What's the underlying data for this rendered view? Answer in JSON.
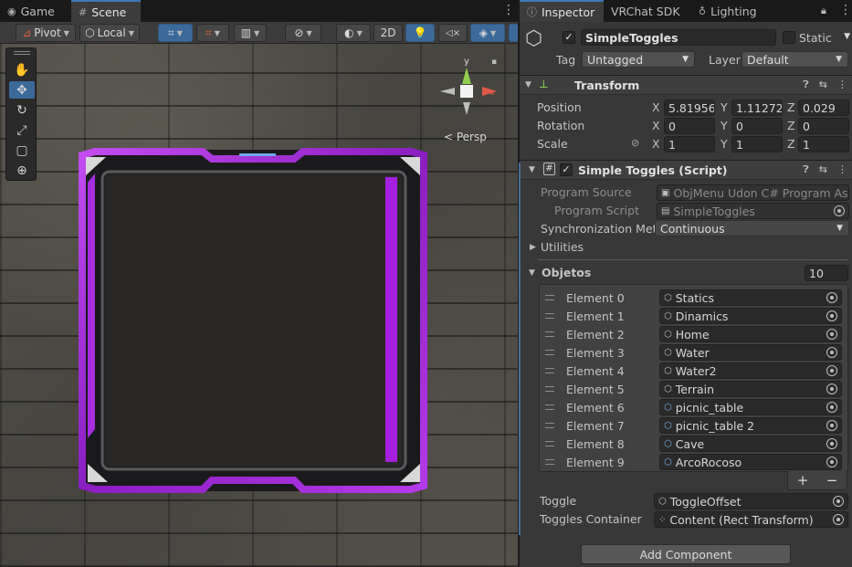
{
  "scene_tabs": [
    {
      "label": "Game",
      "icon": "gamepad-icon"
    },
    {
      "label": "Scene",
      "icon": "grid-icon"
    }
  ],
  "scene_toolbar": {
    "pivot_label": "Pivot",
    "local_label": "Local",
    "mode_2d_label": "2D"
  },
  "scene": {
    "projection_label": "< Persp",
    "gizmo_y": "y",
    "gizmo_x": "x",
    "frame_accent": "#a61fe0"
  },
  "inspector_tabs": [
    {
      "label": "Inspector",
      "icon": "info-icon"
    },
    {
      "label": "VRChat SDK",
      "icon": ""
    },
    {
      "label": "Lighting",
      "icon": "bulb-icon"
    }
  ],
  "gameobject": {
    "name": "SimpleToggles",
    "static_label": "Static",
    "tag_label": "Tag",
    "tag_value": "Untagged",
    "layer_label": "Layer",
    "layer_value": "Default"
  },
  "transform": {
    "title": "Transform",
    "position_label": "Position",
    "rotation_label": "Rotation",
    "scale_label": "Scale",
    "position": {
      "x": "5.819569",
      "y": "1.112724",
      "z": "0.029"
    },
    "rotation": {
      "x": "0",
      "y": "0",
      "z": "0"
    },
    "scale": {
      "x": "1",
      "y": "1",
      "z": "1"
    },
    "axis_x": "X",
    "axis_y": "Y",
    "axis_z": "Z"
  },
  "script": {
    "title": "Simple Toggles (Script)",
    "program_source_label": "Program Source",
    "program_source_value": "ObjMenu Udon C# Program Ass",
    "program_script_label": "Program Script",
    "program_script_value": "SimpleToggles",
    "sync_label": "Synchronization Meth",
    "sync_value": "Continuous",
    "utilities_label": "Utilities",
    "objetos_label": "Objetos",
    "objetos_count": "10",
    "elements": [
      {
        "label": "Element 0",
        "value": "Statics",
        "prefab": false
      },
      {
        "label": "Element 1",
        "value": "Dinamics",
        "prefab": false
      },
      {
        "label": "Element 2",
        "value": "Home",
        "prefab": false
      },
      {
        "label": "Element 3",
        "value": "Water",
        "prefab": false
      },
      {
        "label": "Element 4",
        "value": "Water2",
        "prefab": false
      },
      {
        "label": "Element 5",
        "value": "Terrain",
        "prefab": false
      },
      {
        "label": "Element 6",
        "value": "picnic_table",
        "prefab": true
      },
      {
        "label": "Element 7",
        "value": "picnic_table 2",
        "prefab": true
      },
      {
        "label": "Element 8",
        "value": "Cave",
        "prefab": true
      },
      {
        "label": "Element 9",
        "value": "ArcoRocoso",
        "prefab": true
      }
    ],
    "add_label": "+",
    "remove_label": "−",
    "toggle_label": "Toggle",
    "toggle_value": "ToggleOffset",
    "container_label": "Toggles Container",
    "container_value": "Content (Rect Transform)"
  },
  "add_component_label": "Add Component"
}
